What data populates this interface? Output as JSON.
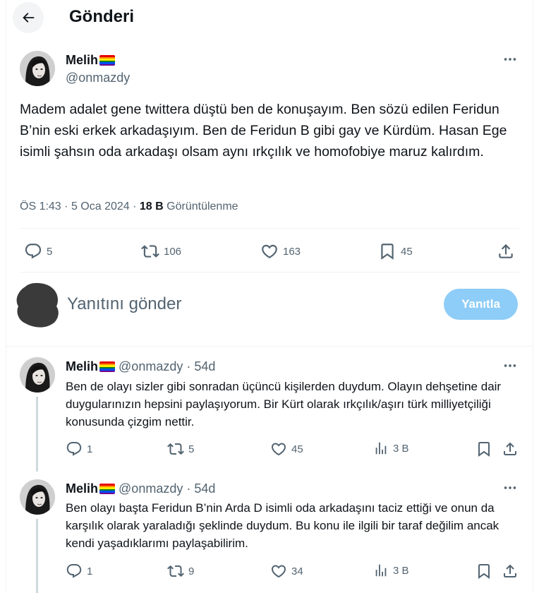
{
  "header": {
    "title": "Gönderi"
  },
  "colors": {
    "accent": "#1d9bf0",
    "reply_button_disabled": "#8ecdf7",
    "muted": "#536471",
    "text": "#0f1419"
  },
  "main_tweet": {
    "author_name": "Melih",
    "author_handle": "@onmazdy",
    "name_flag": "rainbow-flag-emoji",
    "text": "Madem adalet gene twittera düştü ben de konuşayım. Ben sözü edilen Feridun B’nin eski erkek arkadaşıyım. Ben de Feridun B gibi gay ve Kürdüm. Hasan Ege isimli şahsın oda arkadaşı olsam aynı ırkçılık ve homofobiye maruz kalırdım.",
    "time": "ÖS 1:43",
    "date": "5 Oca 2024",
    "separator": "·",
    "views_count": "18 B",
    "views_label": "Görüntülenme",
    "stats": {
      "replies": "5",
      "reposts": "106",
      "likes": "163",
      "bookmarks": "45"
    }
  },
  "composer": {
    "placeholder": "Yanıtını gönder",
    "button_label": "Yanıtla"
  },
  "replies": [
    {
      "author_name": "Melih",
      "author_handle": "@onmazdy",
      "age": "· 54d",
      "text": "Ben de olayı sizler gibi sonradan üçüncü kişilerden duydum. Olayın dehşetine dair duygularınızın hepsini paylaşıyorum. Bir Kürt olarak ırkçılık/aşırı türk milliyetçiliği konusunda çizgim nettir.",
      "stats": {
        "replies": "1",
        "reposts": "5",
        "likes": "45",
        "views": "3 B"
      }
    },
    {
      "author_name": "Melih",
      "author_handle": "@onmazdy",
      "age": "· 54d",
      "text": "Ben olayı başta Feridun B’nin Arda D isimli oda arkadaşını taciz ettiği ve onun da karşılık olarak yaraladığı şeklinde duydum. Bu konu ile ilgili bir taraf değilim ancak kendi yaşadıklarımı paylaşabilirim.",
      "stats": {
        "replies": "1",
        "reposts": "9",
        "likes": "34",
        "views": "3 B"
      }
    }
  ]
}
